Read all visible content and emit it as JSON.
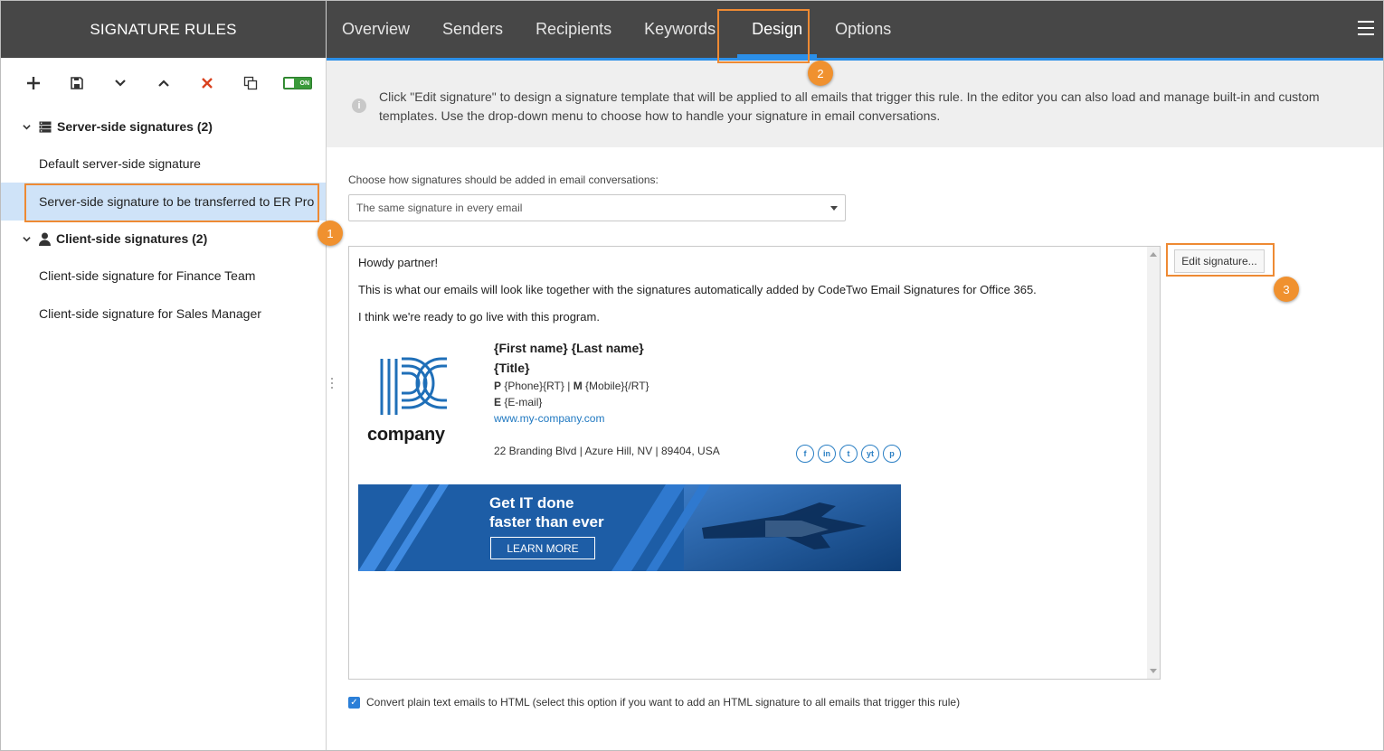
{
  "sidebar": {
    "title": "SIGNATURE RULES",
    "toggle_label": "ON",
    "groups": [
      {
        "label": "Server-side signatures (2)",
        "items": [
          {
            "label": "Default server-side signature"
          },
          {
            "label": "Server-side signature to be transferred to ER Pro"
          }
        ]
      },
      {
        "label": "Client-side signatures (2)",
        "items": [
          {
            "label": "Client-side signature for Finance Team"
          },
          {
            "label": "Client-side signature for Sales Manager"
          }
        ]
      }
    ]
  },
  "tabs": [
    {
      "label": "Overview"
    },
    {
      "label": "Senders"
    },
    {
      "label": "Recipients"
    },
    {
      "label": "Keywords"
    },
    {
      "label": "Design"
    },
    {
      "label": "Options"
    }
  ],
  "active_tab": "Design",
  "info_text": "Click \"Edit signature\" to design a signature template that will be applied to all emails that trigger this rule. In the editor you can also load and manage built-in and custom templates. Use the drop-down menu to choose how to handle your signature in email conversations.",
  "conversation": {
    "label": "Choose how signatures should be added in email conversations:",
    "selected": "The same signature in every email"
  },
  "preview": {
    "greeting": "Howdy partner!",
    "body1": "This is what our emails will look like together with the signatures automatically added by CodeTwo Email Signatures for Office 365.",
    "body2": "I think we're ready to go live with this program.",
    "logo_text": "company",
    "name": "{First name} {Last name}",
    "title": "{Title}",
    "phone_prefix": "P",
    "phone": "{Phone}{RT}",
    "sep": "|",
    "mobile_prefix": "M",
    "mobile": "{Mobile}{/RT}",
    "email_prefix": "E",
    "email": "{E-mail}",
    "website": "www.my-company.com",
    "address": "22 Branding Blvd | Azure Hill, NV | 89404, USA",
    "socials": [
      "f",
      "in",
      "t",
      "yt",
      "p"
    ],
    "banner_line1": "Get IT done",
    "banner_line2": "faster than ever",
    "banner_cta": "LEARN MORE"
  },
  "edit_button": "Edit signature...",
  "convert_label": "Convert plain text emails to HTML (select this option if you want to add an HTML signature to all emails that trigger this rule)",
  "callouts": [
    "1",
    "2",
    "3"
  ],
  "colors": {
    "header_bg": "#474747",
    "accent": "#2b8fe8",
    "highlight": "#ee8a33",
    "selected_row": "#cfe3f8"
  }
}
